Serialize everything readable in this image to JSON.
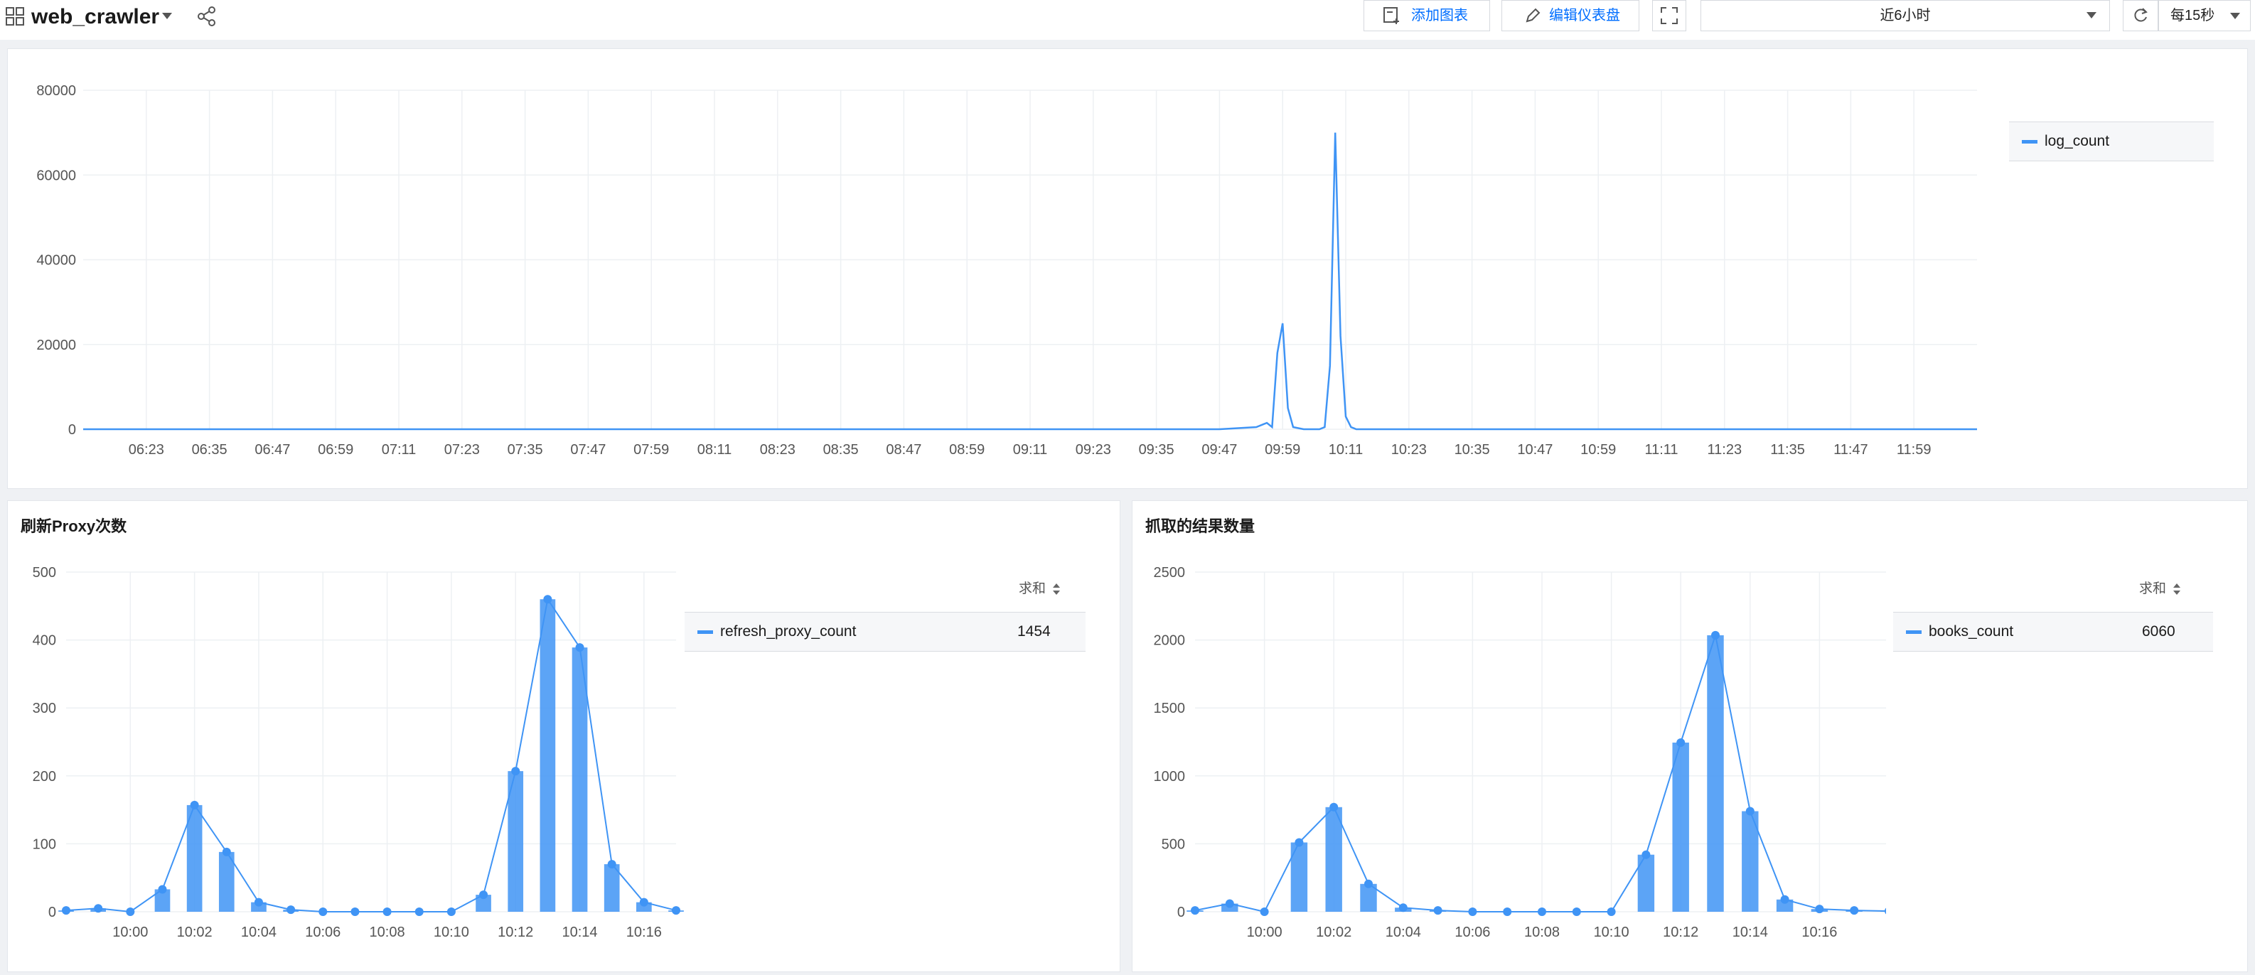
{
  "dashboard": {
    "title": "web_crawler",
    "add_chart_label": "添加图表",
    "edit_dashboard_label": "编辑仪表盘",
    "time_range": "近6小时",
    "refresh_interval": "每15秒"
  },
  "colors": {
    "series": "#3f94f5",
    "accent": "#006eff"
  },
  "panels": {
    "log": {
      "legend_name": "log_count"
    },
    "proxy": {
      "title": "刷新Proxy次数",
      "legend_header": "求和",
      "legend_name": "refresh_proxy_count",
      "legend_value": "1454"
    },
    "books": {
      "title": "抓取的结果数量",
      "legend_header": "求和",
      "legend_name": "books_count",
      "legend_value": "6060"
    }
  },
  "chart_data": [
    {
      "type": "line",
      "series": [
        {
          "name": "log_count",
          "x": [
            "06:11",
            "06:23",
            "06:35",
            "06:47",
            "06:59",
            "07:11",
            "07:23",
            "07:35",
            "07:47",
            "07:59",
            "08:11",
            "08:23",
            "08:35",
            "08:47",
            "08:59",
            "09:11",
            "09:23",
            "09:35",
            "09:47",
            "09:54",
            "09:56",
            "09:57",
            "09:58",
            "09:59",
            "10:00",
            "10:01",
            "10:03",
            "10:06",
            "10:07",
            "10:08",
            "10:09",
            "10:10",
            "10:11",
            "10:12",
            "10:13",
            "10:14",
            "10:23",
            "10:35",
            "10:47",
            "10:59",
            "11:11",
            "11:23",
            "11:35",
            "11:47",
            "11:59",
            "12:11"
          ],
          "values": [
            0,
            0,
            0,
            0,
            0,
            0,
            0,
            0,
            0,
            0,
            0,
            0,
            0,
            0,
            0,
            0,
            0,
            0,
            0,
            500,
            1500,
            500,
            18000,
            25000,
            5000,
            500,
            0,
            0,
            500,
            15000,
            70000,
            22000,
            3000,
            500,
            0,
            0,
            0,
            0,
            0,
            0,
            0,
            0,
            0,
            0,
            0,
            0
          ]
        }
      ],
      "x_ticks": [
        "06:23",
        "06:35",
        "06:47",
        "06:59",
        "07:11",
        "07:23",
        "07:35",
        "07:47",
        "07:59",
        "08:11",
        "08:23",
        "08:35",
        "08:47",
        "08:59",
        "09:11",
        "09:23",
        "09:35",
        "09:47",
        "09:59",
        "10:11",
        "10:23",
        "10:35",
        "10:47",
        "10:59",
        "11:11",
        "11:23",
        "11:35",
        "11:47",
        "11:59"
      ],
      "y_ticks": [
        0,
        20000,
        40000,
        60000,
        80000
      ],
      "ylim": [
        0,
        80000
      ],
      "grid": true,
      "legend": "right"
    },
    {
      "type": "bar",
      "title": "刷新Proxy次数",
      "categories": [
        "09:58",
        "09:59",
        "10:00",
        "10:01",
        "10:02",
        "10:03",
        "10:04",
        "10:05",
        "10:06",
        "10:07",
        "10:08",
        "10:09",
        "10:10",
        "10:11",
        "10:12",
        "10:13",
        "10:14",
        "10:15",
        "10:16",
        "10:17"
      ],
      "series": [
        {
          "name": "refresh_proxy_count",
          "values": [
            2,
            5,
            0,
            33,
            157,
            88,
            14,
            3,
            0,
            0,
            0,
            0,
            0,
            25,
            207,
            460,
            389,
            70,
            14,
            2
          ]
        }
      ],
      "x_ticks": [
        "10:00",
        "10:02",
        "10:04",
        "10:06",
        "10:08",
        "10:10",
        "10:12",
        "10:14",
        "10:16"
      ],
      "y_ticks": [
        0,
        100,
        200,
        300,
        400,
        500
      ],
      "ylim": [
        0,
        500
      ],
      "grid": true,
      "legend": "right"
    },
    {
      "type": "bar",
      "title": "抓取的结果数量",
      "categories": [
        "09:58",
        "09:59",
        "10:00",
        "10:01",
        "10:02",
        "10:03",
        "10:04",
        "10:05",
        "10:06",
        "10:07",
        "10:08",
        "10:09",
        "10:10",
        "10:11",
        "10:12",
        "10:13",
        "10:14",
        "10:15",
        "10:16",
        "10:17",
        "10:18"
      ],
      "series": [
        {
          "name": "books_count",
          "values": [
            10,
            60,
            0,
            510,
            770,
            205,
            30,
            10,
            0,
            0,
            0,
            0,
            0,
            420,
            1245,
            2035,
            740,
            90,
            20,
            10,
            5
          ]
        }
      ],
      "x_ticks": [
        "10:00",
        "10:02",
        "10:04",
        "10:06",
        "10:08",
        "10:10",
        "10:12",
        "10:14",
        "10:16"
      ],
      "y_ticks": [
        0,
        500,
        1000,
        1500,
        2000,
        2500
      ],
      "ylim": [
        0,
        2500
      ],
      "grid": true,
      "legend": "right"
    }
  ]
}
